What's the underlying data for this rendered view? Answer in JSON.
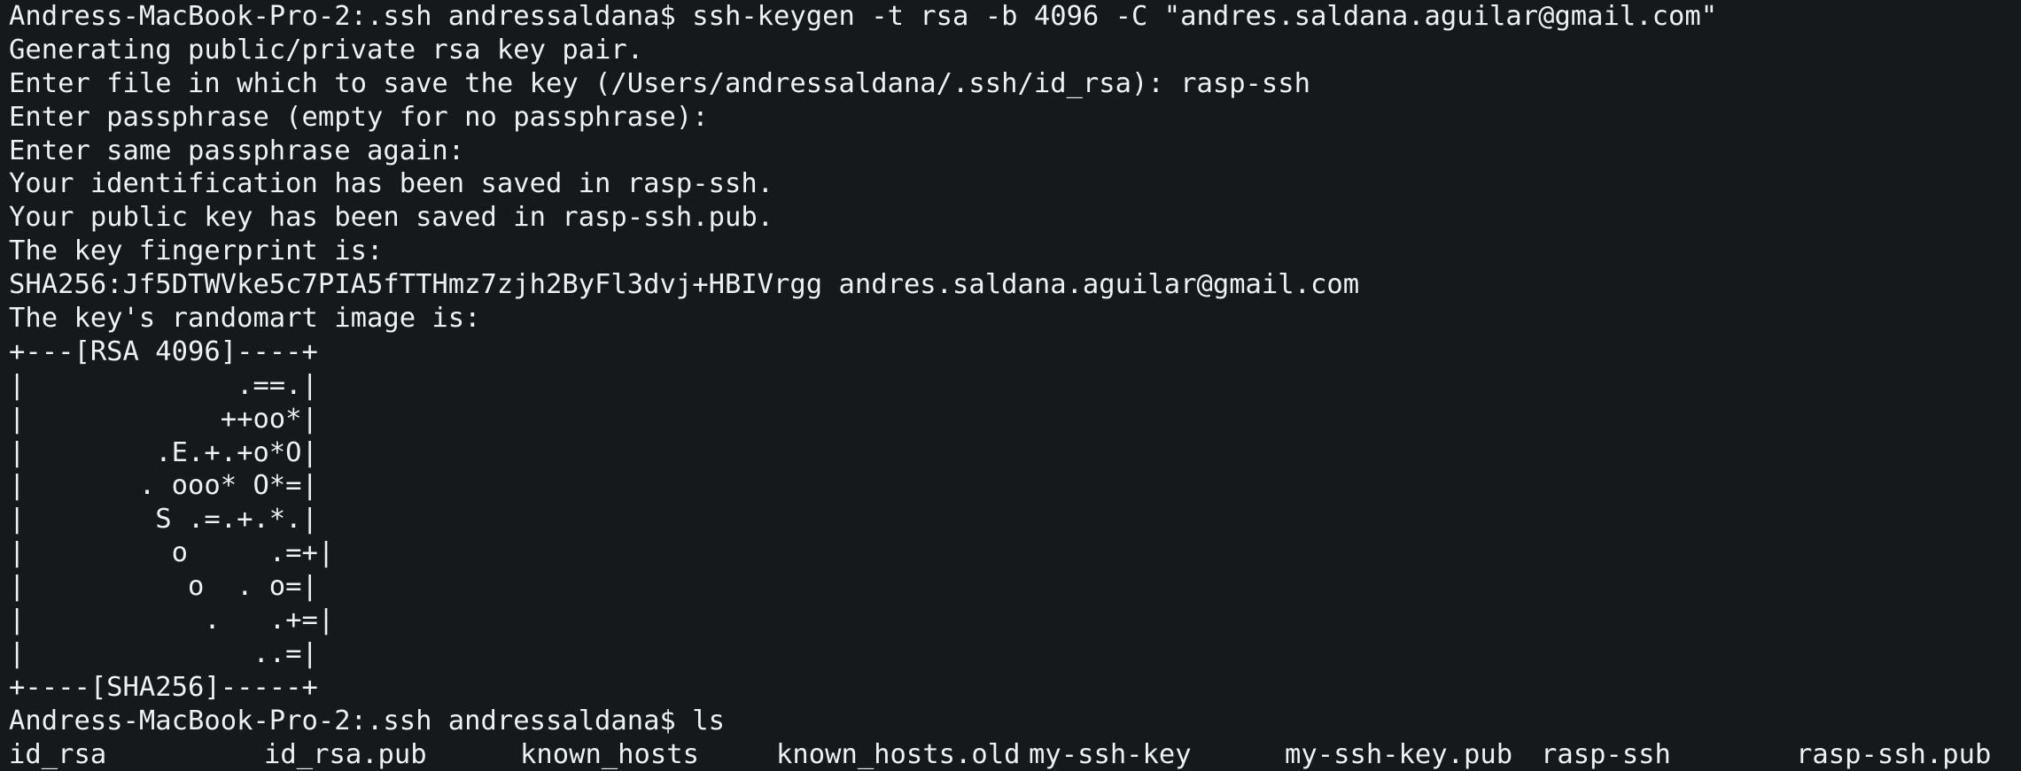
{
  "terminal": {
    "lines": [
      "Andress-MacBook-Pro-2:.ssh andressaldana$ ssh-keygen -t rsa -b 4096 -C \"andres.saldana.aguilar@gmail.com\"",
      "Generating public/private rsa key pair.",
      "Enter file in which to save the key (/Users/andressaldana/.ssh/id_rsa): rasp-ssh",
      "Enter passphrase (empty for no passphrase):",
      "Enter same passphrase again:",
      "Your identification has been saved in rasp-ssh.",
      "Your public key has been saved in rasp-ssh.pub.",
      "The key fingerprint is:",
      "SHA256:Jf5DTWVke5c7PIA5fTTHmz7zjh2ByFl3dvj+HBIVrgg andres.saldana.aguilar@gmail.com",
      "The key's randomart image is:",
      "+---[RSA 4096]----+",
      "|             .==.|",
      "|            ++oo*|",
      "|        .E.+.+o*O|",
      "|       . ooo* O*=|",
      "|        S .=.+.*.|",
      "|         o     .=+|",
      "|          o  . o=|",
      "|           .   .+=|",
      "|              ..=|",
      "+----[SHA256]-----+",
      "Andress-MacBook-Pro-2:.ssh andressaldana$ ls"
    ],
    "ls_output": [
      "id_rsa",
      "id_rsa.pub",
      "known_hosts",
      "known_hosts.old",
      "my-ssh-key",
      "my-ssh-key.pub",
      "rasp-ssh",
      "rasp-ssh.pub"
    ]
  }
}
